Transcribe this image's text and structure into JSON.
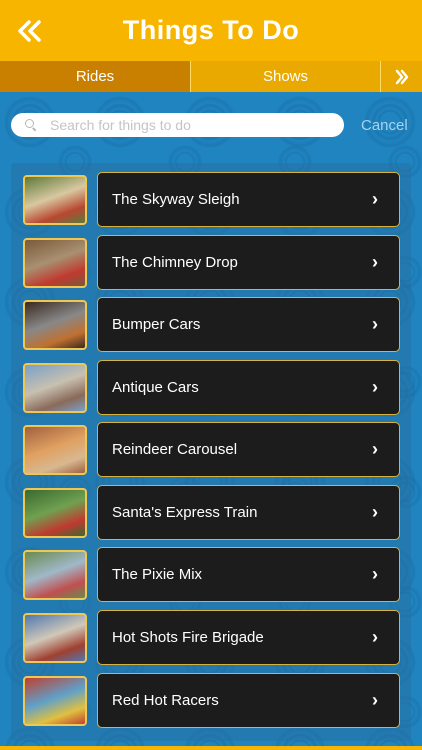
{
  "header": {
    "title": "Things To Do",
    "back_icon": "double-chevron-left-icon"
  },
  "tabs": [
    {
      "label": "Rides",
      "selected": true
    },
    {
      "label": "Shows",
      "selected": false
    }
  ],
  "tabs_next_icon": "double-chevron-right-icon",
  "search": {
    "placeholder": "Search for things to do",
    "value": "",
    "cancel_label": "Cancel"
  },
  "items": [
    {
      "label": "The Skyway Sleigh",
      "thumb_colors": [
        "#5d7a3a",
        "#b84830",
        "#d8c8a0"
      ]
    },
    {
      "label": "The Chimney Drop",
      "thumb_colors": [
        "#7a5a3a",
        "#c03a30",
        "#a89070"
      ]
    },
    {
      "label": "Bumper Cars",
      "thumb_colors": [
        "#3a2a20",
        "#c07030",
        "#888888"
      ]
    },
    {
      "label": "Antique Cars",
      "thumb_colors": [
        "#7aa0c8",
        "#8a6a5a",
        "#c8c0b0"
      ]
    },
    {
      "label": "Reindeer Carousel",
      "thumb_colors": [
        "#a06040",
        "#d8b890",
        "#e0a060"
      ]
    },
    {
      "label": "Santa's Express Train",
      "thumb_colors": [
        "#3a6a30",
        "#c03a30",
        "#70a050"
      ]
    },
    {
      "label": "The Pixie Mix",
      "thumb_colors": [
        "#6a8a50",
        "#c05050",
        "#a0b8c8"
      ]
    },
    {
      "label": "Hot Shots Fire Brigade",
      "thumb_colors": [
        "#5078b0",
        "#a04030",
        "#d0c8b8"
      ]
    },
    {
      "label": "Red Hot Racers",
      "thumb_colors": [
        "#c04030",
        "#e0c040",
        "#60a0c8"
      ]
    }
  ],
  "colors": {
    "header": "#f7b500",
    "tab_selected": "#c97f00",
    "tab": "#e9a900",
    "card_bg": "#1c1c1c",
    "card_border": "#d8b240",
    "background": "#1f84c0"
  }
}
